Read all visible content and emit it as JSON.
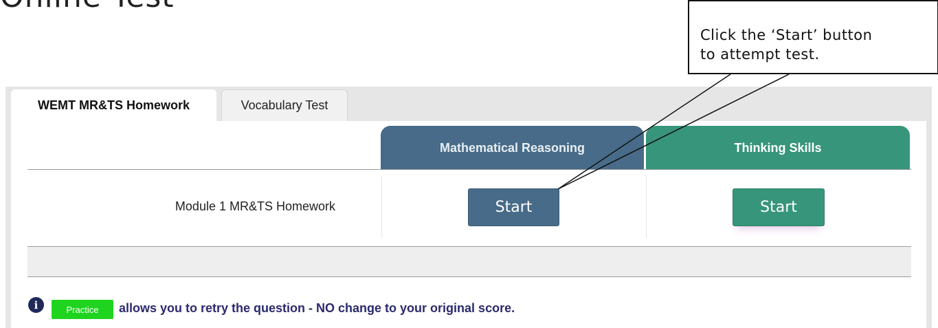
{
  "page_title": "Online Test",
  "tabs": [
    {
      "label": "WEMT MR&TS Homework",
      "active": true
    },
    {
      "label": "Vocabulary Test",
      "active": false
    }
  ],
  "columns": [
    {
      "label": "Mathematical Reasoning",
      "color": "#476b88"
    },
    {
      "label": "Thinking Skills",
      "color": "#36957a"
    }
  ],
  "rows": [
    {
      "label": "Module 1 MR&TS Homework",
      "math_button": "Start",
      "thinking_button": "Start"
    }
  ],
  "info": {
    "icon": "info-icon",
    "badge_label": "Practice",
    "badge_color": "#1fd41f",
    "text": "allows you to retry the question - NO change to your original score."
  },
  "callout": {
    "line1": "Click the ‘Start’ button",
    "line2": "to attempt test."
  }
}
